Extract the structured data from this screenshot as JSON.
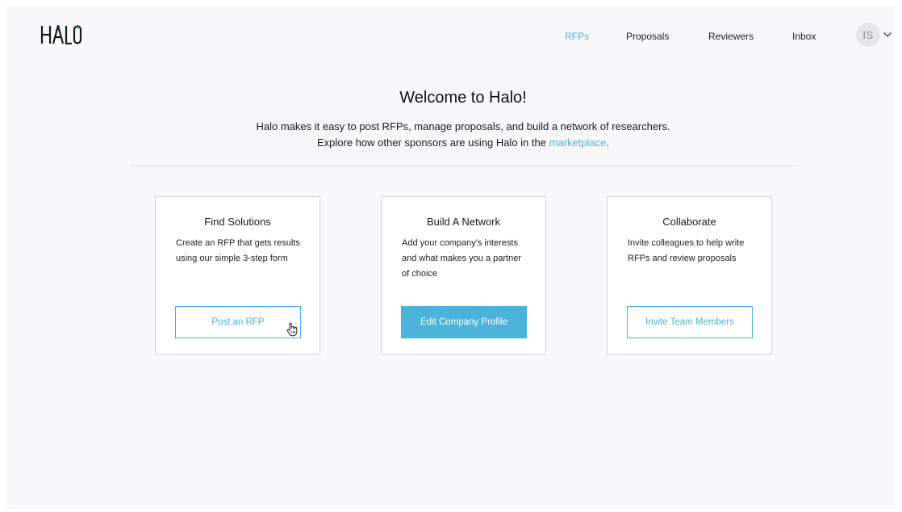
{
  "brand": {
    "logo_text": "HALO",
    "accent_color": "#4bb2d9"
  },
  "nav": {
    "items": [
      {
        "label": "RFPs",
        "active": true
      },
      {
        "label": "Proposals",
        "active": false
      },
      {
        "label": "Reviewers",
        "active": false
      },
      {
        "label": "Inbox",
        "active": false
      }
    ]
  },
  "user": {
    "initials": "IS",
    "menu_icon": "chevron-down-icon"
  },
  "hero": {
    "title": "Welcome to Halo!",
    "line1": "Halo makes it easy to post RFPs, manage proposals, and build a network of researchers.",
    "line2_prefix": "Explore how other sponsors are using Halo in the ",
    "line2_link": "marketplace",
    "line2_suffix": "."
  },
  "cards": [
    {
      "title": "Find Solutions",
      "text": "Create an RFP that gets results using our simple 3-step form",
      "button": "Post an RFP"
    },
    {
      "title": "Build A Network",
      "text": "Add your company's interests and what makes you a partner of choice",
      "button": "Edit Company Profile"
    },
    {
      "title": "Collaborate",
      "text": "Invite colleagues to help write RFPs and review proposals",
      "button": "Invite Team Members"
    }
  ]
}
